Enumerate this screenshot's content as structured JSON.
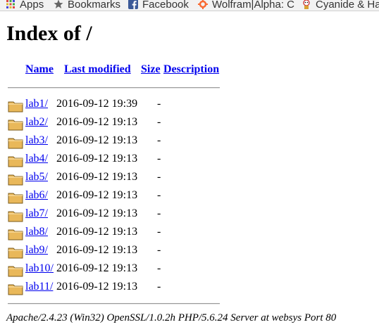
{
  "bookmarks": {
    "apps": "Apps",
    "bookmarks": "Bookmarks",
    "facebook": "Facebook",
    "wolfram": "Wolfram|Alpha: C",
    "cyanide": "Cyanide & Ha"
  },
  "page": {
    "title": "Index of /",
    "columns": {
      "name": "Name",
      "last_modified": "Last modified",
      "size": "Size",
      "description": "Description"
    },
    "entries": [
      {
        "name": "lab1/",
        "modified": "2016-09-12 19:39",
        "size": "-"
      },
      {
        "name": "lab2/",
        "modified": "2016-09-12 19:13",
        "size": "-"
      },
      {
        "name": "lab3/",
        "modified": "2016-09-12 19:13",
        "size": "-"
      },
      {
        "name": "lab4/",
        "modified": "2016-09-12 19:13",
        "size": "-"
      },
      {
        "name": "lab5/",
        "modified": "2016-09-12 19:13",
        "size": "-"
      },
      {
        "name": "lab6/",
        "modified": "2016-09-12 19:13",
        "size": "-"
      },
      {
        "name": "lab7/",
        "modified": "2016-09-12 19:13",
        "size": "-"
      },
      {
        "name": "lab8/",
        "modified": "2016-09-12 19:13",
        "size": "-"
      },
      {
        "name": "lab9/",
        "modified": "2016-09-12 19:13",
        "size": "-"
      },
      {
        "name": "lab10/",
        "modified": "2016-09-12 19:13",
        "size": "-"
      },
      {
        "name": "lab11/",
        "modified": "2016-09-12 19:13",
        "size": "-"
      }
    ],
    "footer": "Apache/2.4.23 (Win32) OpenSSL/1.0.2h PHP/5.6.24 Server at websys Port 80"
  },
  "icons": {
    "apps": "apps-grid-icon",
    "bookmarks": "star-icon",
    "facebook": "facebook-icon",
    "wolfram": "wolfram-icon",
    "cyanide": "cyanide-icon",
    "folder": "folder-icon"
  },
  "colors": {
    "link": "#0000ee",
    "facebook": "#3b5998",
    "wolfram": "#f96932",
    "folder": "#e9b85a"
  }
}
